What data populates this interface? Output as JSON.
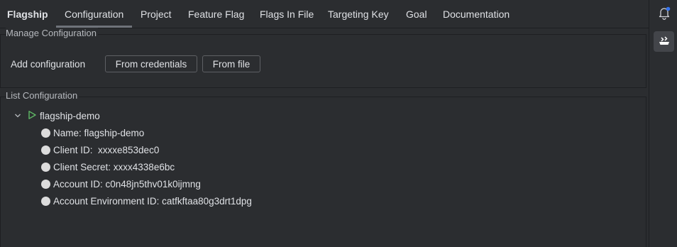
{
  "tabs": [
    {
      "label": "Flagship"
    },
    {
      "label": "Configuration"
    },
    {
      "label": "Project"
    },
    {
      "label": "Feature Flag"
    },
    {
      "label": "Flags In File"
    },
    {
      "label": "Targeting Key"
    },
    {
      "label": "Goal"
    },
    {
      "label": "Documentation"
    }
  ],
  "manage": {
    "title": "Manage Configuration",
    "add_label": "Add configuration",
    "from_credentials": "From credentials",
    "from_file": "From file"
  },
  "list": {
    "title": "List Configuration",
    "config_name": "flagship-demo",
    "fields": [
      {
        "text": "Name: flagship-demo"
      },
      {
        "text": "Client ID:  xxxxe853dec0"
      },
      {
        "text": "Client Secret: xxxx4338e6bc"
      },
      {
        "text": "Account ID: c0n48jn5thv01k0ijmng"
      },
      {
        "text": "Account Environment ID: catfkftaa80g3drt1dpg"
      }
    ]
  },
  "right_strip": {
    "notifications_icon": "bell-icon",
    "plugin_icon": "flagship-plugin-icon"
  },
  "colors": {
    "background": "#2b2d30",
    "run_icon": "#5fb865",
    "notification_dot": "#3574f0"
  }
}
